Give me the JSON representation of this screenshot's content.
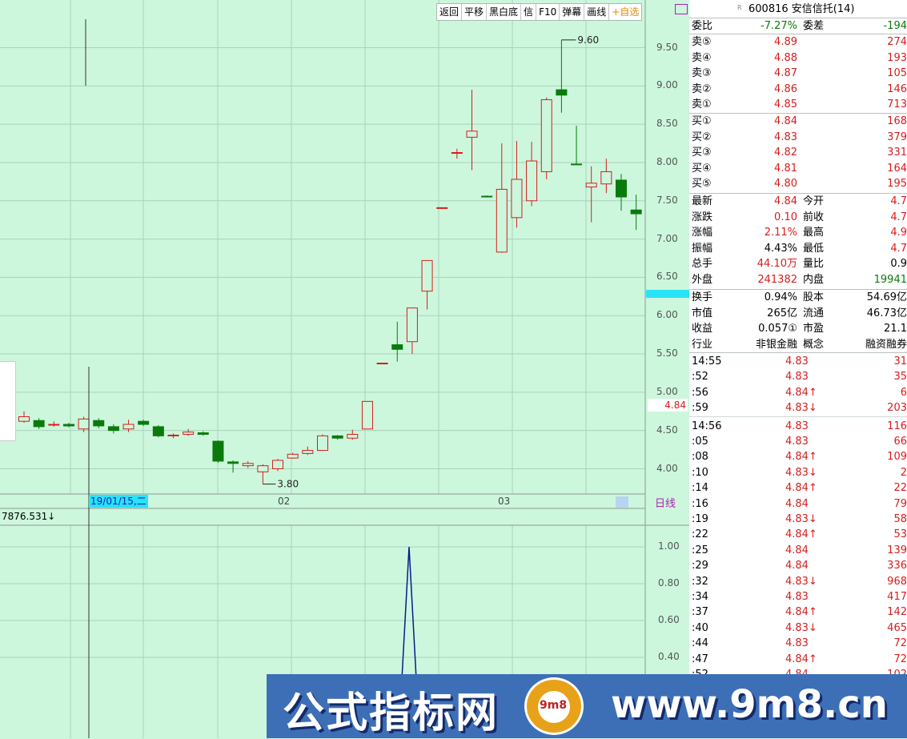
{
  "toolbar": {
    "items": [
      "返回",
      "平移",
      "黑白底",
      "信",
      "F10",
      "弹幕",
      "画线"
    ],
    "fav": "自选"
  },
  "colors": {
    "up": "#d61d1d",
    "down": "#0a7a0a",
    "bg": "#ccf7dd",
    "highlight": "#28e4f6",
    "indicator_line": "#0a1a8c"
  },
  "price_axis": {
    "ticks": [
      "9.50",
      "9.00",
      "8.50",
      "8.00",
      "7.50",
      "7.00",
      "6.50",
      "6.00",
      "5.50",
      "5.00",
      "4.50",
      "4.00"
    ],
    "current": "4.84"
  },
  "date_axis": {
    "cursor_date": "19/01/15,二",
    "labels": [
      "02",
      "03"
    ],
    "period": "日线"
  },
  "indicator": {
    "value_text": "7876.531↓",
    "ticks": [
      "1.00",
      "0.80",
      "0.60",
      "0.40"
    ]
  },
  "chart_data": {
    "type": "candlestick",
    "max_label": "9.60",
    "min_label": "3.80",
    "ylim": [
      3.6,
      9.8
    ],
    "candles": [
      {
        "o": 4.62,
        "c": 4.68,
        "h": 4.75,
        "l": 4.6
      },
      {
        "o": 4.63,
        "c": 4.55,
        "h": 4.66,
        "l": 4.52
      },
      {
        "o": 4.57,
        "c": 4.58,
        "h": 4.62,
        "l": 4.55
      },
      {
        "o": 4.58,
        "c": 4.56,
        "h": 4.6,
        "l": 4.54
      },
      {
        "o": 4.52,
        "c": 4.65,
        "h": 4.68,
        "l": 4.48
      },
      {
        "o": 4.63,
        "c": 4.56,
        "h": 4.66,
        "l": 4.53
      },
      {
        "o": 4.55,
        "c": 4.5,
        "h": 4.58,
        "l": 4.46
      },
      {
        "o": 4.52,
        "c": 4.58,
        "h": 4.64,
        "l": 4.48
      },
      {
        "o": 4.62,
        "c": 4.58,
        "h": 4.64,
        "l": 4.56
      },
      {
        "o": 4.55,
        "c": 4.43,
        "h": 4.57,
        "l": 4.41
      },
      {
        "o": 4.43,
        "c": 4.44,
        "h": 4.46,
        "l": 4.4
      },
      {
        "o": 4.45,
        "c": 4.48,
        "h": 4.52,
        "l": 4.43
      },
      {
        "o": 4.47,
        "c": 4.45,
        "h": 4.49,
        "l": 4.43
      },
      {
        "o": 4.36,
        "c": 4.1,
        "h": 4.37,
        "l": 4.08
      },
      {
        "o": 4.09,
        "c": 4.07,
        "h": 4.11,
        "l": 3.95
      },
      {
        "o": 4.04,
        "c": 4.07,
        "h": 4.1,
        "l": 4.01
      },
      {
        "o": 3.96,
        "c": 4.04,
        "h": 4.06,
        "l": 3.8
      },
      {
        "o": 4.0,
        "c": 4.11,
        "h": 4.13,
        "l": 3.97
      },
      {
        "o": 4.14,
        "c": 4.19,
        "h": 4.21,
        "l": 4.13
      },
      {
        "o": 4.2,
        "c": 4.24,
        "h": 4.29,
        "l": 4.18
      },
      {
        "o": 4.24,
        "c": 4.43,
        "h": 4.45,
        "l": 4.24
      },
      {
        "o": 4.43,
        "c": 4.4,
        "h": 4.44,
        "l": 4.38
      },
      {
        "o": 4.4,
        "c": 4.45,
        "h": 4.51,
        "l": 4.38
      },
      {
        "o": 4.52,
        "c": 4.88,
        "h": 4.88,
        "l": 4.52
      },
      {
        "o": 5.37,
        "c": 5.38,
        "h": 5.38,
        "l": 5.37
      },
      {
        "o": 5.62,
        "c": 5.56,
        "h": 5.92,
        "l": 5.4
      },
      {
        "o": 5.66,
        "c": 6.1,
        "h": 6.1,
        "l": 5.5
      },
      {
        "o": 6.32,
        "c": 6.72,
        "h": 6.72,
        "l": 6.08
      },
      {
        "o": 7.4,
        "c": 7.41,
        "h": 7.41,
        "l": 7.4
      },
      {
        "o": 8.12,
        "c": 8.13,
        "h": 8.18,
        "l": 8.05
      },
      {
        "o": 8.33,
        "c": 8.41,
        "h": 8.95,
        "l": 7.9
      },
      {
        "o": 7.56,
        "c": 7.55,
        "h": 7.57,
        "l": 7.55
      },
      {
        "o": 6.83,
        "c": 7.65,
        "h": 8.25,
        "l": 6.82
      },
      {
        "o": 7.28,
        "c": 7.78,
        "h": 8.28,
        "l": 7.15
      },
      {
        "o": 7.5,
        "c": 8.02,
        "h": 8.27,
        "l": 7.43
      },
      {
        "o": 7.88,
        "c": 8.82,
        "h": 8.85,
        "l": 7.78
      },
      {
        "o": 8.95,
        "c": 8.88,
        "h": 9.6,
        "l": 8.65
      },
      {
        "o": 7.98,
        "c": 7.97,
        "h": 8.48,
        "l": 7.97
      },
      {
        "o": 7.68,
        "c": 7.73,
        "h": 7.95,
        "l": 7.22
      },
      {
        "o": 7.72,
        "c": 7.88,
        "h": 8.05,
        "l": 7.6
      },
      {
        "o": 7.77,
        "c": 7.55,
        "h": 7.85,
        "l": 7.37
      },
      {
        "o": 7.38,
        "c": 7.33,
        "h": 7.58,
        "l": 7.12
      }
    ],
    "indicator_series": [
      0,
      0,
      0,
      0,
      0,
      0,
      0,
      0,
      0,
      0,
      0,
      0,
      0,
      0,
      0,
      0,
      0,
      0,
      0,
      0,
      0,
      0,
      0,
      0,
      0,
      0,
      0,
      0,
      0,
      0,
      0,
      0,
      0,
      0,
      0,
      0,
      0,
      0,
      0,
      0,
      0,
      0,
      1.0,
      0
    ]
  },
  "quote": {
    "code": "600816",
    "name": "安信信托(14)",
    "weibi_label": "委比",
    "weibi": "-7.27%",
    "weicha_label": "委差",
    "weicha": "-194",
    "asks": [
      {
        "label": "卖⑤",
        "price": "4.89",
        "vol": "274"
      },
      {
        "label": "卖④",
        "price": "4.88",
        "vol": "193"
      },
      {
        "label": "卖③",
        "price": "4.87",
        "vol": "105"
      },
      {
        "label": "卖②",
        "price": "4.86",
        "vol": "146"
      },
      {
        "label": "卖①",
        "price": "4.85",
        "vol": "713"
      }
    ],
    "bids": [
      {
        "label": "买①",
        "price": "4.84",
        "vol": "168"
      },
      {
        "label": "买②",
        "price": "4.83",
        "vol": "379"
      },
      {
        "label": "买③",
        "price": "4.82",
        "vol": "331"
      },
      {
        "label": "买④",
        "price": "4.81",
        "vol": "164"
      },
      {
        "label": "买⑤",
        "price": "4.80",
        "vol": "195"
      }
    ],
    "stats1": [
      {
        "l": "最新",
        "v": "4.84",
        "l2": "今开",
        "v2": "4.7"
      },
      {
        "l": "涨跌",
        "v": "0.10",
        "l2": "前收",
        "v2": "4.7"
      },
      {
        "l": "涨幅",
        "v": "2.11%",
        "l2": "最高",
        "v2": "4.9"
      },
      {
        "l": "振幅",
        "v": "4.43%",
        "l2": "最低",
        "v2": "4.7"
      },
      {
        "l": "总手",
        "v": "44.10万",
        "l2": "量比",
        "v2": "0.9"
      },
      {
        "l": "外盘",
        "v": "241382",
        "l2": "内盘",
        "v2": "19941"
      }
    ],
    "stats2": [
      {
        "l": "换手",
        "v": "0.94%",
        "l2": "股本",
        "v2": "54.69亿"
      },
      {
        "l": "市值",
        "v": "265亿",
        "l2": "流通",
        "v2": "46.73亿"
      },
      {
        "l": "收益",
        "v": "0.057①",
        "l2": "市盈",
        "v2": "21.1"
      },
      {
        "l": "行业",
        "v": "非银金融",
        "l2": "概念",
        "v2": "融资融券"
      }
    ],
    "ticks": [
      {
        "t": "14:55",
        "p": "4.83",
        "v": "31"
      },
      {
        "t": ":52",
        "p": "4.83",
        "v": "35"
      },
      {
        "t": ":56",
        "p": "4.84↑",
        "v": "6"
      },
      {
        "t": ":59",
        "p": "4.83↓",
        "v": "203"
      },
      {
        "t": "14:56",
        "p": "4.83",
        "v": "116"
      },
      {
        "t": ":05",
        "p": "4.83",
        "v": "66"
      },
      {
        "t": ":08",
        "p": "4.84↑",
        "v": "109"
      },
      {
        "t": ":10",
        "p": "4.83↓",
        "v": "2"
      },
      {
        "t": ":14",
        "p": "4.84↑",
        "v": "22"
      },
      {
        "t": ":16",
        "p": "4.84",
        "v": "79"
      },
      {
        "t": ":19",
        "p": "4.83↓",
        "v": "58"
      },
      {
        "t": ":22",
        "p": "4.84↑",
        "v": "53"
      },
      {
        "t": ":25",
        "p": "4.84",
        "v": "139"
      },
      {
        "t": ":29",
        "p": "4.84",
        "v": "336"
      },
      {
        "t": ":32",
        "p": "4.83↓",
        "v": "968"
      },
      {
        "t": ":34",
        "p": "4.83",
        "v": "417"
      },
      {
        "t": ":37",
        "p": "4.84↑",
        "v": "142"
      },
      {
        "t": ":40",
        "p": "4.83↓",
        "v": "465"
      },
      {
        "t": ":44",
        "p": "4.83",
        "v": "72"
      },
      {
        "t": ":47",
        "p": "4.84↑",
        "v": "72"
      },
      {
        "t": ":52",
        "p": "4.84",
        "v": "102"
      }
    ]
  },
  "watermark": {
    "text": "公式指标网",
    "url": "www.9m8.cn",
    "seal": "9m8"
  }
}
